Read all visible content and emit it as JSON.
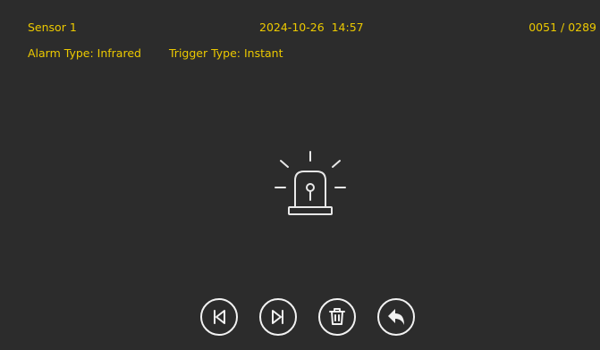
{
  "header": {
    "sensor_name": "Sensor 1",
    "datetime": "2024-10-26  14:57",
    "record_counter": "0051 / 0289",
    "alarm_type": "Alarm Type: Infrared",
    "trigger_type": "Trigger Type: Instant"
  },
  "colors": {
    "background": "#2c2c2c",
    "text": "#ecc900",
    "icon": "#e8e8e8"
  },
  "icons": {
    "main": "alarm-siren-icon",
    "controls": [
      "skip-previous-icon",
      "skip-next-icon",
      "trash-icon",
      "undo-arrow-icon"
    ]
  }
}
